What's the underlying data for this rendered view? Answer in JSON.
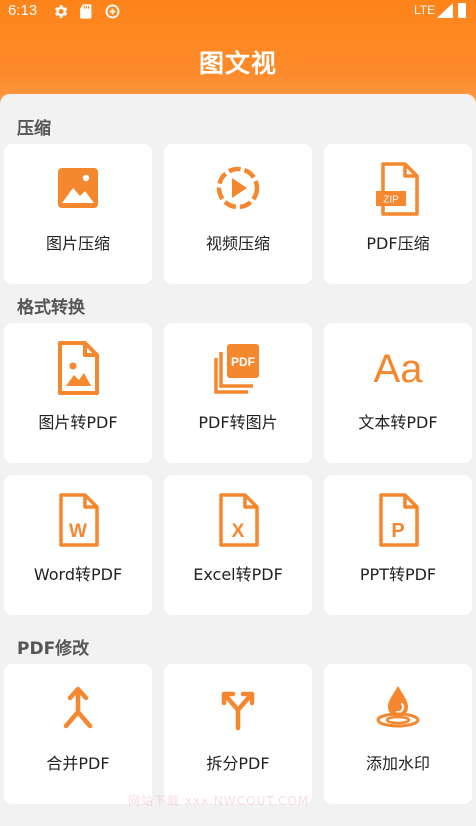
{
  "status_bar": {
    "time": "6:13",
    "network": "LTE"
  },
  "app": {
    "title": "图文视"
  },
  "colors": {
    "accent": "#fe8419",
    "icon": "#f5872e"
  },
  "sections": [
    {
      "title": "压缩",
      "items": [
        {
          "label": "图片压缩",
          "icon": "image-icon"
        },
        {
          "label": "视频压缩",
          "icon": "video-play-icon"
        },
        {
          "label": "PDF压缩",
          "icon": "zip-file-icon",
          "icon_text": "ZIP"
        }
      ]
    },
    {
      "title": "格式转换",
      "items": [
        {
          "label": "图片转PDF",
          "icon": "image-file-icon"
        },
        {
          "label": "PDF转图片",
          "icon": "pdf-stack-icon",
          "icon_text": "PDF"
        },
        {
          "label": "文本转PDF",
          "icon": "text-aa-icon",
          "icon_text": "Aa"
        },
        {
          "label": "Word转PDF",
          "icon": "word-file-icon",
          "icon_text": "W"
        },
        {
          "label": "Excel转PDF",
          "icon": "excel-file-icon",
          "icon_text": "X"
        },
        {
          "label": "PPT转PDF",
          "icon": "ppt-file-icon",
          "icon_text": "P"
        }
      ]
    },
    {
      "title": "PDF修改",
      "items": [
        {
          "label": "合并PDF",
          "icon": "merge-icon"
        },
        {
          "label": "拆分PDF",
          "icon": "split-icon"
        },
        {
          "label": "添加水印",
          "icon": "watermark-drop-icon"
        }
      ]
    }
  ],
  "watermark": "网站下载 xxx.NWCOUT.COM"
}
